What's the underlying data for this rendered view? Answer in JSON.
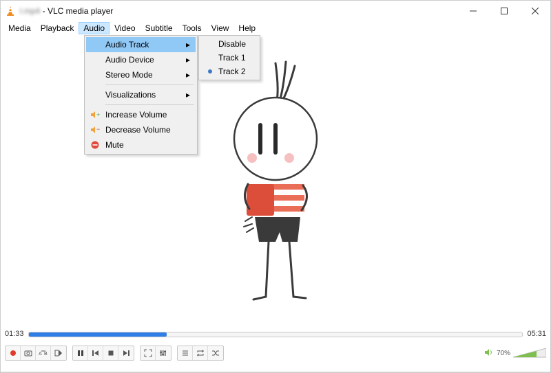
{
  "window": {
    "title_filename": "l.mp4",
    "title_suffix": " - VLC media player"
  },
  "menus": [
    "Media",
    "Playback",
    "Audio",
    "Video",
    "Subtitle",
    "Tools",
    "View",
    "Help"
  ],
  "audio_menu": {
    "audio_track": "Audio Track",
    "audio_device": "Audio Device",
    "stereo_mode": "Stereo Mode",
    "visualizations": "Visualizations",
    "increase_volume": "Increase Volume",
    "decrease_volume": "Decrease Volume",
    "mute": "Mute"
  },
  "audio_track_submenu": {
    "disable": "Disable",
    "track1": "Track 1",
    "track2": "Track 2",
    "selected": "track2"
  },
  "player": {
    "elapsed": "01:33",
    "duration": "05:31",
    "progress_percent": 28,
    "volume_percent": "70%"
  }
}
